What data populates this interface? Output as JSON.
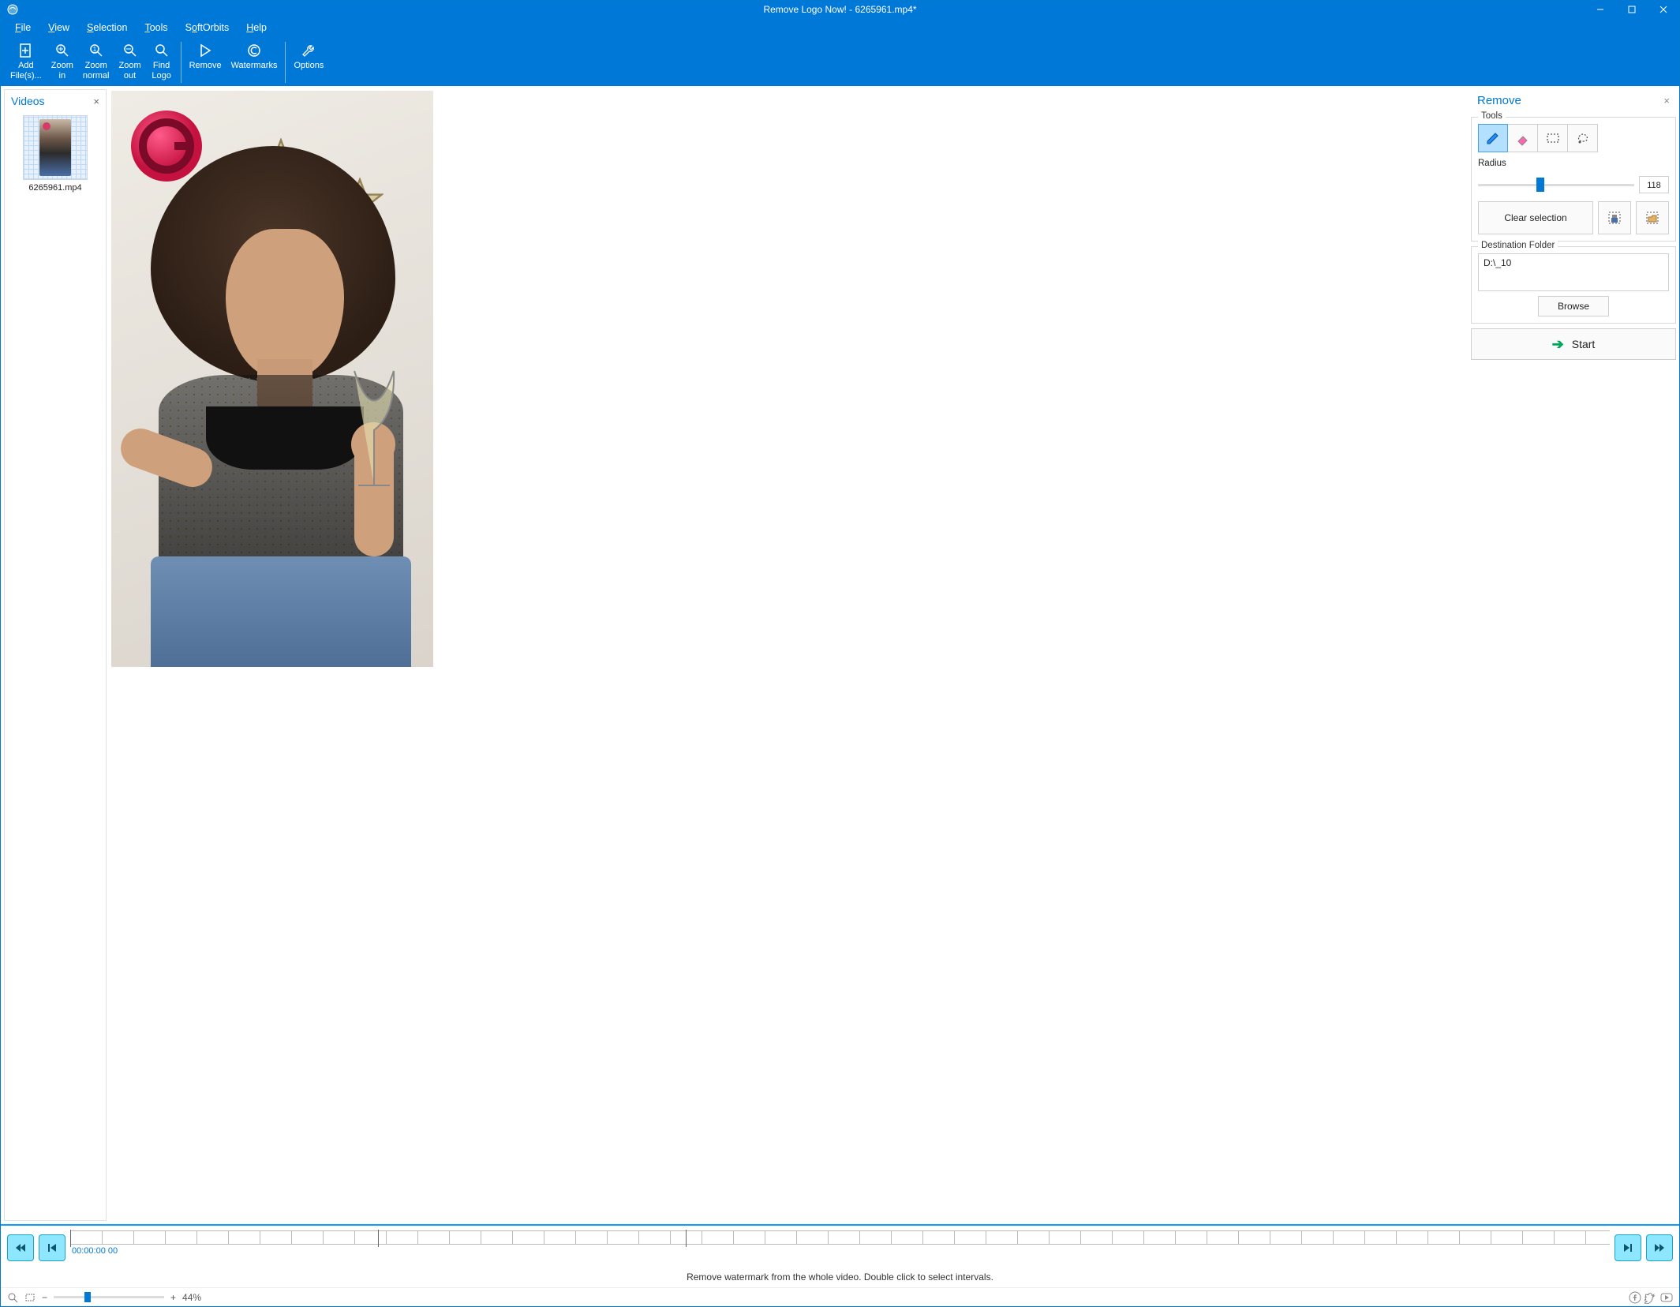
{
  "title": "Remove Logo Now! - 6265961.mp4*",
  "menu": {
    "file": "File",
    "view": "View",
    "selection": "Selection",
    "tools": "Tools",
    "softorbits": "SoftOrbits",
    "help": "Help"
  },
  "toolbar": {
    "add_files": "Add\nFile(s)...",
    "zoom_in": "Zoom\nin",
    "zoom_normal": "Zoom\nnormal",
    "zoom_out": "Zoom\nout",
    "find_logo": "Find\nLogo",
    "remove": "Remove",
    "watermarks": "Watermarks",
    "options": "Options"
  },
  "left_panel": {
    "title": "Videos",
    "items": [
      {
        "filename": "6265961.mp4"
      }
    ]
  },
  "right_panel": {
    "title": "Remove",
    "tools_label": "Tools",
    "radius_label": "Radius",
    "radius_value": "118",
    "clear_selection": "Clear selection",
    "dest_label": "Destination Folder",
    "dest_path": "D:\\_10",
    "browse": "Browse",
    "start": "Start"
  },
  "timeline": {
    "timecode": "00:00:00 00",
    "hint": "Remove watermark from the whole video. Double click to select intervals."
  },
  "statusbar": {
    "zoom_pct": "44%"
  },
  "colors": {
    "accent": "#0078d7",
    "timeline": "#0aa0ff"
  }
}
